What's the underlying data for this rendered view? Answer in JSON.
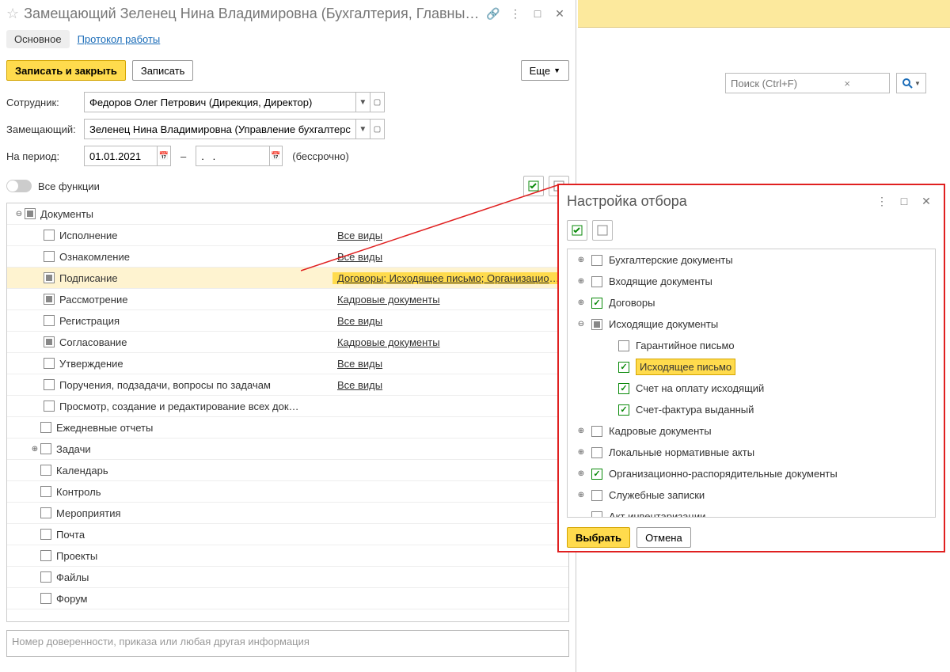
{
  "window": {
    "title": "Замещающий Зеленец Нина Владимировна (Бухгалтерия, Главны…",
    "tabs": {
      "main": "Основное",
      "log": "Протокол работы"
    },
    "buttons": {
      "save_close": "Записать и закрыть",
      "save": "Записать",
      "more": "Еще"
    }
  },
  "form": {
    "employee_label": "Сотрудник:",
    "employee_value": "Федоров Олег Петрович (Дирекция, Директор)",
    "substitute_label": "Замещающий:",
    "substitute_value": "Зеленец Нина Владимировна (Управление бухгалтерского у",
    "period_label": "На период:",
    "date_from": "01.01.2021",
    "date_to": ".   .",
    "period_suffix": "(бессрочно)",
    "all_functions": "Все функции"
  },
  "tree": {
    "root": "Документы",
    "rows": [
      {
        "label": "Исполнение",
        "link": "Все виды",
        "cb": "empty"
      },
      {
        "label": "Ознакомление",
        "link": "Все виды",
        "cb": "empty"
      },
      {
        "label": "Подписание",
        "link": "Договоры; Исходящее письмо; Организационно-расп…",
        "cb": "partial",
        "hl": true
      },
      {
        "label": "Рассмотрение",
        "link": "Кадровые документы",
        "cb": "partial"
      },
      {
        "label": "Регистрация",
        "link": "Все виды",
        "cb": "empty"
      },
      {
        "label": "Согласование",
        "link": "Кадровые документы",
        "cb": "partial"
      },
      {
        "label": "Утверждение",
        "link": "Все виды",
        "cb": "empty"
      },
      {
        "label": "Поручения, подзадачи, вопросы по задачам",
        "link": "Все виды",
        "cb": "empty"
      },
      {
        "label": "Просмотр, создание и редактирование всех док…",
        "link": "",
        "cb": "empty"
      }
    ],
    "others": [
      "Ежедневные отчеты",
      "Задачи",
      "Календарь",
      "Контроль",
      "Мероприятия",
      "Почта",
      "Проекты",
      "Файлы",
      "Форум"
    ]
  },
  "comment_placeholder": "Номер доверенности, приказа или любая другая информация",
  "search": {
    "placeholder": "Поиск (Ctrl+F)"
  },
  "popup": {
    "title": "Настройка отбора",
    "rows": [
      {
        "label": "Бухгалтерские документы",
        "lvl": 1,
        "exp": "+",
        "cb": "empty"
      },
      {
        "label": "Входящие документы",
        "lvl": 1,
        "exp": "+",
        "cb": "empty"
      },
      {
        "label": "Договоры",
        "lvl": 1,
        "exp": "+",
        "cb": "checked"
      },
      {
        "label": "Исходящие документы",
        "lvl": 1,
        "exp": "-",
        "cb": "partial"
      },
      {
        "label": "Гарантийное письмо",
        "lvl": 2,
        "exp": "",
        "cb": "empty"
      },
      {
        "label": "Исходящее письмо",
        "lvl": 2,
        "exp": "",
        "cb": "checked",
        "hl": true
      },
      {
        "label": "Счет на оплату исходящий",
        "lvl": 2,
        "exp": "",
        "cb": "checked"
      },
      {
        "label": "Счет-фактура выданный",
        "lvl": 2,
        "exp": "",
        "cb": "checked"
      },
      {
        "label": "Кадровые документы",
        "lvl": 1,
        "exp": "+",
        "cb": "empty"
      },
      {
        "label": "Локальные нормативные акты",
        "lvl": 1,
        "exp": "+",
        "cb": "empty"
      },
      {
        "label": "Организационно-распорядительные документы",
        "lvl": 1,
        "exp": "+",
        "cb": "checked"
      },
      {
        "label": "Служебные записки",
        "lvl": 1,
        "exp": "+",
        "cb": "empty"
      },
      {
        "label": "Акт инвентаризации",
        "lvl": 1,
        "exp": "",
        "cb": "empty"
      }
    ],
    "select": "Выбрать",
    "cancel": "Отмена"
  }
}
